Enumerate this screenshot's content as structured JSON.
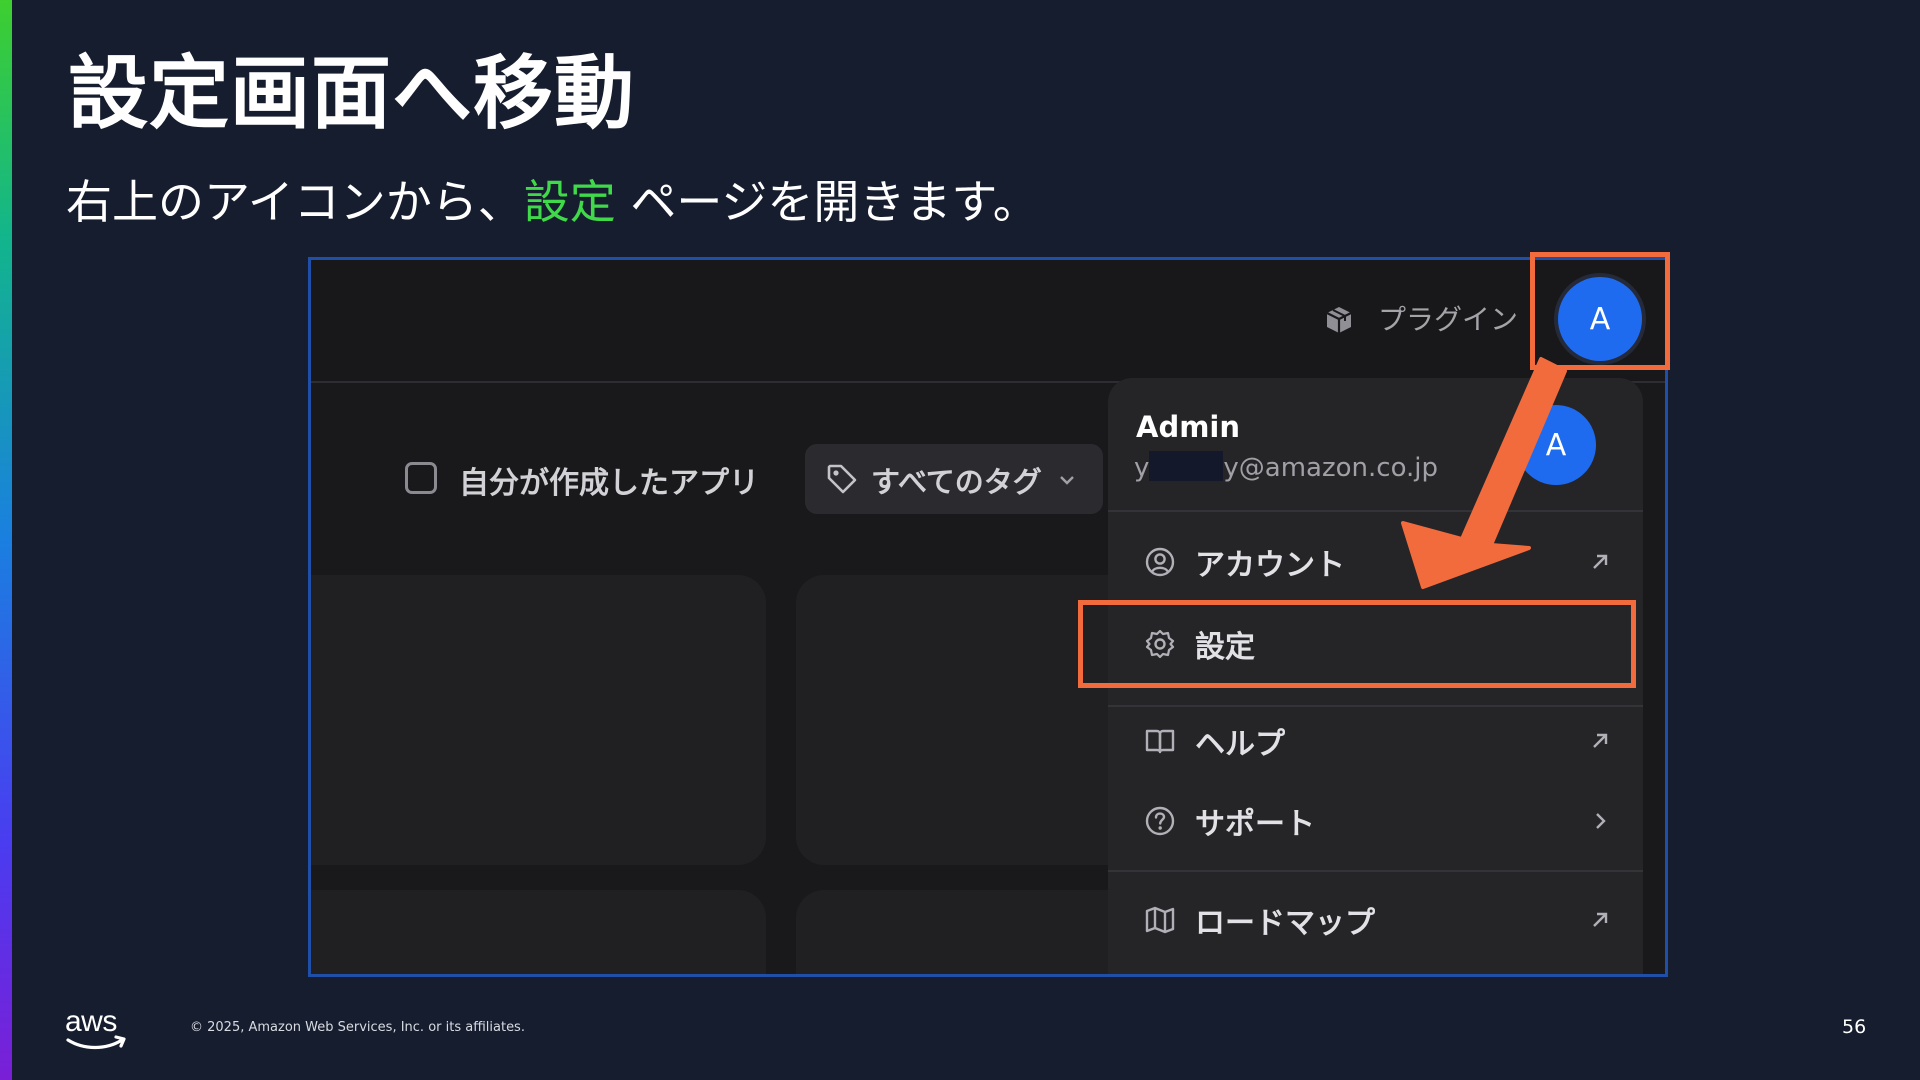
{
  "slide": {
    "title": "設定画面へ移動",
    "subtitle_before": "右上のアイコンから、",
    "subtitle_highlight": "設定",
    "subtitle_after": " ページを開きます。",
    "highlight_color": "#3fd94a",
    "annotation_color": "#f26b3d"
  },
  "app": {
    "topbar": {
      "plugins_label": "プラグイン",
      "avatar_initial": "A"
    },
    "filters": {
      "my_apps_label": "自分が作成したアプリ",
      "my_apps_checked": false,
      "tags_label": "すべてのタグ"
    },
    "user_menu": {
      "name": "Admin",
      "email_prefix": "y",
      "email_suffix": "y@amazon.co.jp",
      "avatar_initial": "A",
      "items": [
        {
          "label": "アカウント",
          "icon": "user-circle-icon",
          "trailing": "external-arrow-icon"
        },
        {
          "label": "設定",
          "icon": "gear-icon",
          "trailing": null,
          "highlighted": true
        },
        {
          "label": "ヘルプ",
          "icon": "book-icon",
          "trailing": "external-arrow-icon"
        },
        {
          "label": "サポート",
          "icon": "question-circle-icon",
          "trailing": "chevron-right-icon"
        },
        {
          "label": "ロードマップ",
          "icon": "map-icon",
          "trailing": "external-arrow-icon"
        }
      ]
    }
  },
  "footer": {
    "logo": "aws",
    "copyright": "© 2025, Amazon Web Services, Inc. or its affiliates.",
    "page_number": "56"
  }
}
